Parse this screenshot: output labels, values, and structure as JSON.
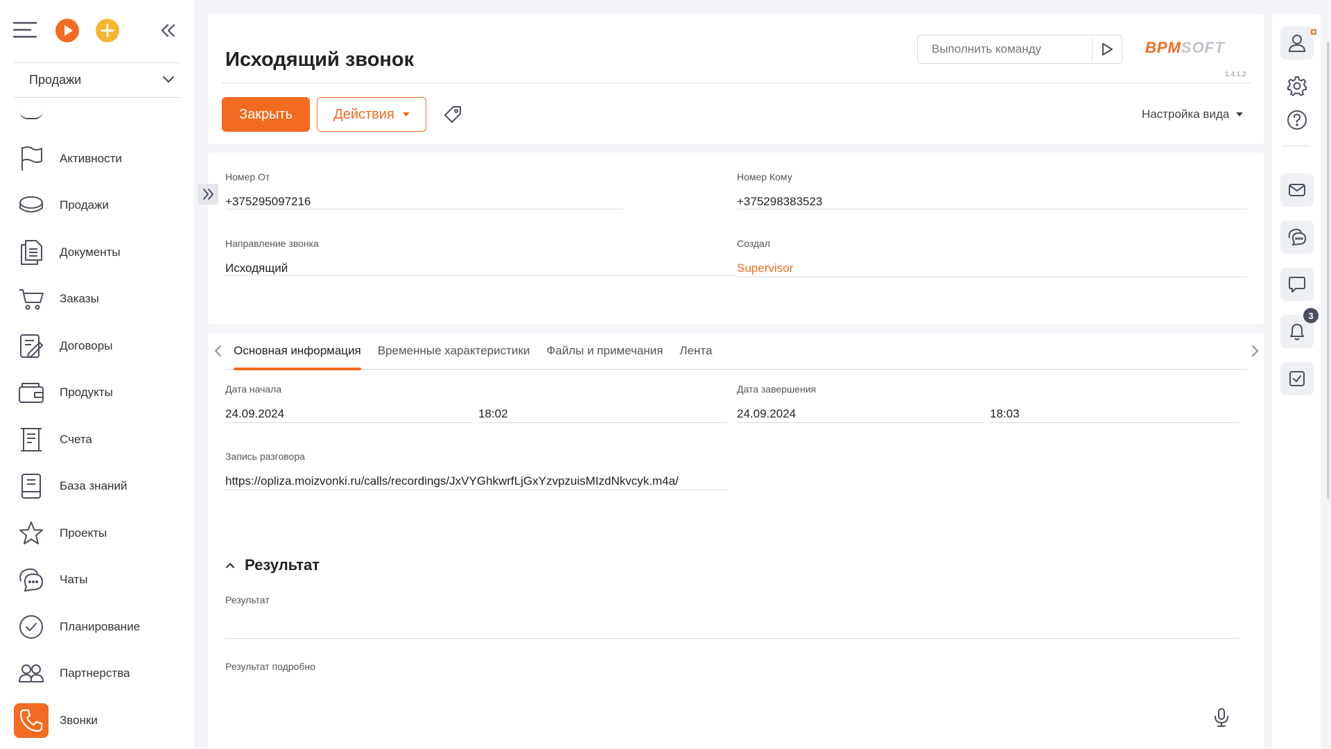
{
  "sidebar": {
    "workspace": "Продажи",
    "items": [
      {
        "label": "Активности",
        "icon": "flag-icon"
      },
      {
        "label": "Продажи",
        "icon": "coin-stack-icon"
      },
      {
        "label": "Документы",
        "icon": "documents-icon"
      },
      {
        "label": "Заказы",
        "icon": "cart-icon"
      },
      {
        "label": "Договоры",
        "icon": "contract-icon"
      },
      {
        "label": "Продукты",
        "icon": "wallet-icon"
      },
      {
        "label": "Счета",
        "icon": "receipt-icon"
      },
      {
        "label": "База знаний",
        "icon": "book-icon"
      },
      {
        "label": "Проекты",
        "icon": "star-icon"
      },
      {
        "label": "Чаты",
        "icon": "chats-icon"
      },
      {
        "label": "Планирование",
        "icon": "check-circle-icon"
      },
      {
        "label": "Партнерства",
        "icon": "partners-icon"
      },
      {
        "label": "Звонки",
        "icon": "phone-icon",
        "active": true
      }
    ]
  },
  "header": {
    "title": "Исходящий звонок",
    "command_placeholder": "Выполнить команду",
    "logo_a": "BPM",
    "logo_b": "SOFT",
    "version": "1.4.1.2",
    "close_label": "Закрыть",
    "actions_label": "Действия",
    "view_settings_label": "Настройка вида"
  },
  "fields": {
    "from_label": "Номер От",
    "from_value": "+375295097216",
    "to_label": "Номер Кому",
    "to_value": "+375298383523",
    "direction_label": "Направление звонка",
    "direction_value": "Исходящий",
    "created_label": "Создал",
    "created_value": "Supervisor"
  },
  "tabs": [
    "Основная информация",
    "Временные характеристики",
    "Файлы и примечания",
    "Лента"
  ],
  "main_info": {
    "start_label": "Дата начала",
    "start_date": "24.09.2024",
    "start_time": "18:02",
    "end_label": "Дата завершения",
    "end_date": "24.09.2024",
    "end_time": "18:03",
    "recording_label": "Запись разговора",
    "recording_value": "https://opliza.moizvonki.ru/calls/recordings/JxVYGhkwrfLjGxYzvpzuisMIzdNkvcyk.m4a/"
  },
  "result_section": {
    "title": "Результат",
    "result_label": "Результат",
    "result_value": "",
    "detail_label": "Результат подробно"
  },
  "notifications_count": "3",
  "colors": {
    "accent": "#f26b21",
    "yellow": "#f6b431",
    "icon": "#4a4f5e"
  }
}
